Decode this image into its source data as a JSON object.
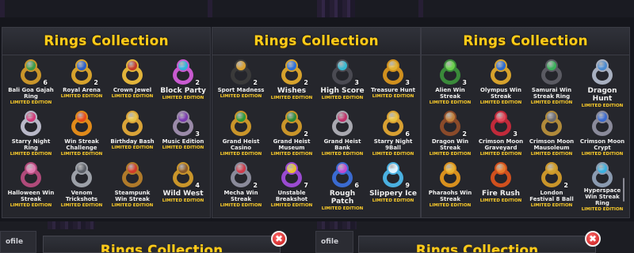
{
  "panels": [
    {
      "title": "Rings Collection",
      "items": [
        {
          "name": "Bali Goa Gajah Ring",
          "count": "6",
          "limited": "LIMITED EDITION",
          "band": "#c9952a",
          "gem": "#3b9a4a",
          "big": false
        },
        {
          "name": "Royal Arena",
          "count": "2",
          "limited": "LIMITED EDITION",
          "band": "#d6a22c",
          "gem": "#2b5fc9",
          "big": false
        },
        {
          "name": "Crown Jewel",
          "count": "",
          "limited": "LIMITED EDITION",
          "band": "#e2b43a",
          "gem": "#c23a2a",
          "big": false
        },
        {
          "name": "Block Party",
          "count": "2",
          "limited": "LIMITED EDITION",
          "band": "#c95ad0",
          "gem": "#2fb3d9",
          "big": true
        },
        {
          "name": "Starry Night Ring",
          "count": "",
          "limited": "LIMITED EDITION",
          "band": "#b8b8c8",
          "gem": "#d23a7a",
          "big": false
        },
        {
          "name": "Win Streak Challenge",
          "count": "",
          "limited": "LIMITED EDITION",
          "band": "#e08a1a",
          "gem": "#e84a1a",
          "big": false
        },
        {
          "name": "Birthday Bash",
          "count": "",
          "limited": "LIMITED EDITION",
          "band": "#d9a338",
          "gem": "#e8c24a",
          "big": false
        },
        {
          "name": "Music Edition",
          "count": "3",
          "limited": "LIMITED EDITION",
          "band": "#9a8aa8",
          "gem": "#7a3ab0",
          "big": false
        },
        {
          "name": "Halloween Win Streak",
          "count": "",
          "limited": "LIMITED EDITION",
          "band": "#b04a7a",
          "gem": "#e07ab0",
          "big": false
        },
        {
          "name": "Venom Trickshots",
          "count": "",
          "limited": "LIMITED EDITION",
          "band": "#9ca0a8",
          "gem": "#5a5e66",
          "big": false
        },
        {
          "name": "Steampunk Win Streak",
          "count": "",
          "limited": "LIMITED EDITION",
          "band": "#b07a2a",
          "gem": "#d23a2a",
          "big": false
        },
        {
          "name": "Wild West",
          "count": "4",
          "limited": "LIMITED EDITION",
          "band": "#c9952a",
          "gem": "#8a5a2a",
          "big": true
        }
      ]
    },
    {
      "title": "Rings Collection",
      "items": [
        {
          "name": "Sport Madness",
          "count": "2",
          "limited": "LIMITED EDITION",
          "band": "#3a3a3a",
          "gem": "#d9a030",
          "big": false
        },
        {
          "name": "Wishes",
          "count": "2",
          "limited": "LIMITED EDITION",
          "band": "#d6a22c",
          "gem": "#2b6fd9",
          "big": true
        },
        {
          "name": "High Score",
          "count": "3",
          "limited": "LIMITED EDITION",
          "band": "#4a4a52",
          "gem": "#35b8d0",
          "big": true
        },
        {
          "name": "Treasure Hunt",
          "count": "3",
          "limited": "LIMITED EDITION",
          "band": "#d0901e",
          "gem": "#e0b030",
          "big": false
        },
        {
          "name": "Grand Heist Casino",
          "count": "",
          "limited": "LIMITED EDITION",
          "band": "#c9952a",
          "gem": "#2a9a3a",
          "big": false
        },
        {
          "name": "Grand Heist Museum",
          "count": "2",
          "limited": "LIMITED EDITION",
          "band": "#c9952a",
          "gem": "#2a8a3a",
          "big": false
        },
        {
          "name": "Grand Heist Bank",
          "count": "",
          "limited": "LIMITED EDITION",
          "band": "#a8a8b0",
          "gem": "#c0306a",
          "big": false
        },
        {
          "name": "Starry Night 9Ball",
          "count": "6",
          "limited": "LIMITED EDITION",
          "band": "#d8a032",
          "gem": "#e8c040",
          "big": false
        },
        {
          "name": "Mecha Win Streak",
          "count": "2",
          "limited": "LIMITED EDITION",
          "band": "#8a8a9a",
          "gem": "#d03a4a",
          "big": false
        },
        {
          "name": "Unstable Breakshot",
          "count": "7",
          "limited": "LIMITED EDITION",
          "band": "#9a4ad0",
          "gem": "#e8c030",
          "big": false
        },
        {
          "name": "Rough Patch",
          "count": "6",
          "limited": "LIMITED EDITION",
          "band": "#3a6ad0",
          "gem": "#c04ad0",
          "big": true
        },
        {
          "name": "Slippery Ice",
          "count": "9",
          "limited": "LIMITED EDITION",
          "band": "#4ab0e0",
          "gem": "#e0f4ff",
          "big": true
        }
      ]
    },
    {
      "title": "Rings Collection",
      "items": [
        {
          "name": "Alien Win Streak",
          "count": "3",
          "limited": "LIMITED EDITION",
          "band": "#3a8a3a",
          "gem": "#6ad04a",
          "big": false
        },
        {
          "name": "Olympus Win Streak",
          "count": "",
          "limited": "LIMITED EDITION",
          "band": "#d6a22c",
          "gem": "#2a6ad0",
          "big": false
        },
        {
          "name": "Samurai Win Streak Ring",
          "count": "",
          "limited": "LIMITED EDITION",
          "band": "#5a5a62",
          "gem": "#3ab05a",
          "big": false
        },
        {
          "name": "Dragon Hunt",
          "count": "",
          "limited": "LIMITED EDITION",
          "band": "#a8b0c0",
          "gem": "#4a8ad0",
          "big": true
        },
        {
          "name": "Dragon Win Streak",
          "count": "2",
          "limited": "LIMITED EDITION",
          "band": "#8a4a2a",
          "gem": "#c0803a",
          "big": false
        },
        {
          "name": "Crimson Moon Graveyard",
          "count": "3",
          "limited": "LIMITED EDITION",
          "band": "#c02a3a",
          "gem": "#e04a5a",
          "big": false
        },
        {
          "name": "Crimson Moon Mausoleum",
          "count": "",
          "limited": "LIMITED EDITION",
          "band": "#b08a3a",
          "gem": "#6a6a72",
          "big": false
        },
        {
          "name": "Crimson Moon Crypt",
          "count": "",
          "limited": "LIMITED EDITION",
          "band": "#8a8a9a",
          "gem": "#3a6ad0",
          "big": false
        },
        {
          "name": "Pharaohs Win Streak",
          "count": "",
          "limited": "LIMITED EDITION",
          "band": "#d8901e",
          "gem": "#e8b030",
          "big": false
        },
        {
          "name": "Fire Rush",
          "count": "",
          "limited": "LIMITED EDITION",
          "band": "#d0501e",
          "gem": "#e87a2a",
          "big": true
        },
        {
          "name": "London Festival 8 Ball",
          "count": "2",
          "limited": "LIMITED EDITION",
          "band": "#c9952a",
          "gem": "#d0a030",
          "big": false
        },
        {
          "name": "Hyperspace Win Streak Ring",
          "count": "",
          "limited": "LIMITED EDITION",
          "band": "#8a9ab0",
          "gem": "#3ab0e0",
          "big": false
        }
      ]
    }
  ],
  "bottom": {
    "tabs": [
      "ofile",
      "ofile"
    ],
    "mini_title": "Rings Collection",
    "close_glyph": "✖"
  }
}
